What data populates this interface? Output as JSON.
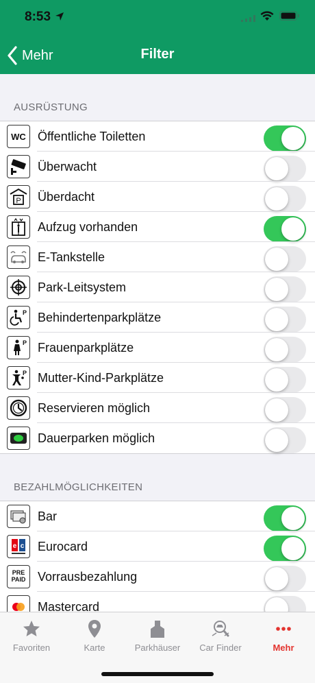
{
  "status": {
    "time": "8:53"
  },
  "nav": {
    "back_label": "Mehr",
    "title": "Filter"
  },
  "sections": [
    {
      "title": "AUSRÜSTUNG",
      "rows": [
        {
          "label": "Öffentliche Toiletten",
          "icon": "wc-icon",
          "on": true
        },
        {
          "label": "Überwacht",
          "icon": "camera-icon",
          "on": false
        },
        {
          "label": "Überdacht",
          "icon": "covered-parking-icon",
          "on": false
        },
        {
          "label": "Aufzug vorhanden",
          "icon": "elevator-icon",
          "on": true
        },
        {
          "label": "E-Tankstelle",
          "icon": "ev-charging-icon",
          "on": false
        },
        {
          "label": "Park-Leitsystem",
          "icon": "guidance-system-icon",
          "on": false
        },
        {
          "label": "Behindertenparkplätze",
          "icon": "wheelchair-parking-icon",
          "on": false
        },
        {
          "label": "Frauenparkplätze",
          "icon": "women-parking-icon",
          "on": false
        },
        {
          "label": "Mutter-Kind-Parkplätze",
          "icon": "mother-child-parking-icon",
          "on": false
        },
        {
          "label": "Reservieren möglich",
          "icon": "clock-icon",
          "on": false
        },
        {
          "label": "Dauerparken möglich",
          "icon": "long-term-parking-icon",
          "on": false
        }
      ]
    },
    {
      "title": "BEZAHLMÖGLICHKEITEN",
      "rows": [
        {
          "label": "Bar",
          "icon": "cash-icon",
          "on": true
        },
        {
          "label": "Eurocard",
          "icon": "eurocard-icon",
          "on": true
        },
        {
          "label": "Vorrausbezahlung",
          "icon": "prepaid-icon",
          "on": false,
          "icon_text": "PRE PAID"
        },
        {
          "label": "Mastercard",
          "icon": "mastercard-icon",
          "on": false
        }
      ]
    }
  ],
  "tabs": [
    {
      "label": "Favoriten",
      "icon": "star-icon",
      "active": false
    },
    {
      "label": "Karte",
      "icon": "map-pin-icon",
      "active": false
    },
    {
      "label": "Parkhäuser",
      "icon": "parking-garage-icon",
      "active": false
    },
    {
      "label": "Car Finder",
      "icon": "car-finder-icon",
      "active": false
    },
    {
      "label": "Mehr",
      "icon": "more-dots-icon",
      "active": true
    }
  ],
  "colors": {
    "header": "#0f9a63",
    "toggle_on": "#34c759",
    "active_tab": "#e3342f"
  }
}
